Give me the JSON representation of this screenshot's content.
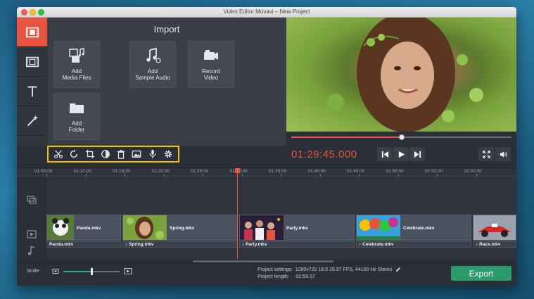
{
  "window": {
    "title": "Video Editor Movavi – New Project"
  },
  "sidebar": {
    "items": [
      {
        "icon": "media-import-icon",
        "active": true
      },
      {
        "icon": "filmstrip-icon",
        "active": false
      },
      {
        "icon": "text-icon",
        "active": false
      },
      {
        "icon": "magic-wand-icon",
        "active": false
      },
      {
        "icon": "menu-icon",
        "active": false
      }
    ]
  },
  "import": {
    "title": "Import",
    "tiles": [
      {
        "line1": "Add",
        "line2": "Media Files",
        "icon": "media-files-icon"
      },
      {
        "line1": "Add",
        "line2": "Sample Audio",
        "icon": "music-note-icon"
      },
      {
        "line1": "Record",
        "line2": "Video",
        "icon": "camera-icon"
      },
      {
        "line1": "Add",
        "line2": "Folder",
        "icon": "folder-icon"
      }
    ]
  },
  "player": {
    "timecode": "01:29:45.000",
    "progress": 0.5
  },
  "tools": [
    "scissors-icon",
    "rotate-icon",
    "crop-icon",
    "color-adjust-icon",
    "trash-icon",
    "image-icon",
    "microphone-icon",
    "gear-icon"
  ],
  "ruler": {
    "ticks": [
      "01:05:00",
      "01:10:00",
      "01:15:00",
      "01:20:00",
      "01:25:00",
      "01:30:00",
      "01:35:00",
      "01:40:00",
      "01:45:00",
      "01:50:00",
      "01:55:00",
      "02:00:00"
    ]
  },
  "clips": [
    {
      "name": "Panda.mkv",
      "audio": "Panda.mkv",
      "audio_note": false
    },
    {
      "name": "Spring.mkv",
      "audio": "Spring.mkv",
      "audio_note": true
    },
    {
      "name": "Party.mkv",
      "audio": "Party.mkv",
      "audio_note": true
    },
    {
      "name": "Celebrate.mkv",
      "audio": "Celebrate.mkv",
      "audio_note": true
    },
    {
      "name": "",
      "audio": "Race.mkv",
      "audio_note": true
    }
  ],
  "bottom": {
    "scale_label": "Scale:",
    "scale_value": 0.5,
    "project_settings_label": "Project settings:",
    "project_settings_value": "1280x720 16:9 29.97 FPS, 44100 Hz Stereo",
    "project_length_label": "Project length:",
    "project_length_value": "02:59:37",
    "export_label": "Export"
  },
  "colors": {
    "accent": "#e8533f",
    "export": "#2b9b6a",
    "highlight": "#f2c200"
  }
}
